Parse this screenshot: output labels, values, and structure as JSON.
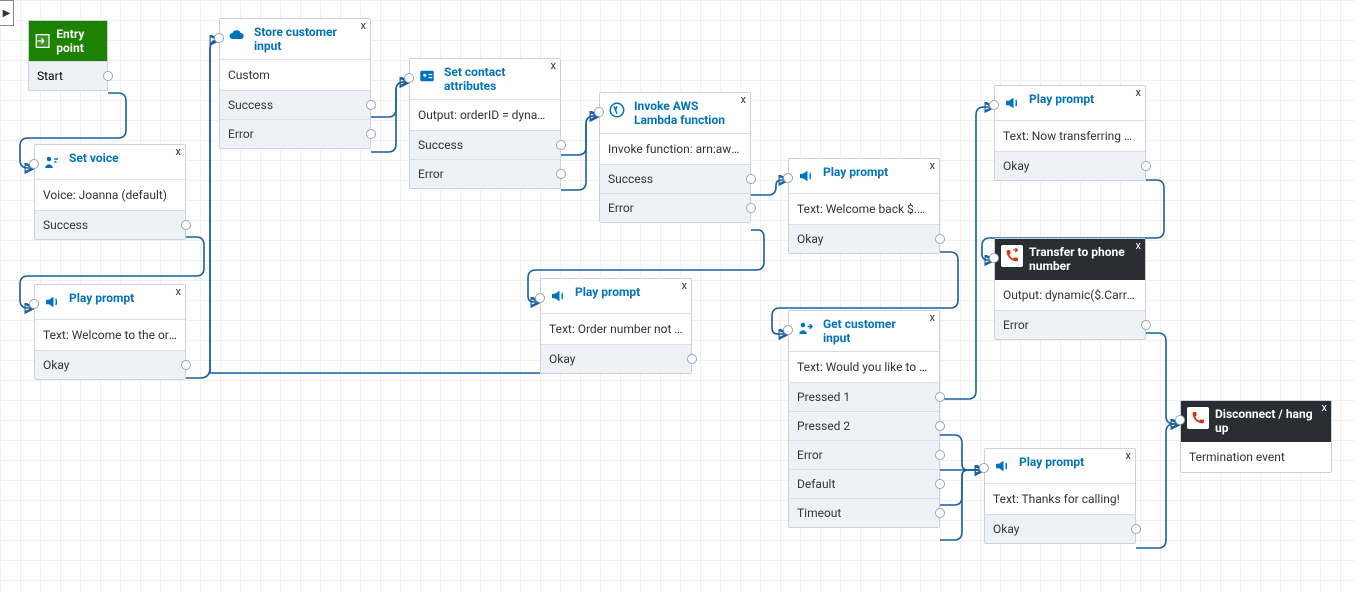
{
  "entry": {
    "title": "Entry point",
    "outLabel": "Start"
  },
  "setVoice": {
    "title": "Set voice",
    "detail": "Voice: Joanna (default)",
    "rows": [
      "Success"
    ]
  },
  "playWelcome": {
    "title": "Play prompt",
    "detail": "Text: Welcome to the order...",
    "rows": [
      "Okay"
    ]
  },
  "storeInput": {
    "title": "Store customer input",
    "detail": "Custom",
    "rows": [
      "Success",
      "Error"
    ]
  },
  "setAttrs": {
    "title": "Set contact attributes",
    "detail": "Output: orderID = dynamic...",
    "rows": [
      "Success",
      "Error"
    ]
  },
  "notFound": {
    "title": "Play prompt",
    "detail": "Text: Order number not fo...",
    "rows": [
      "Okay"
    ]
  },
  "lambda": {
    "title": "Invoke AWS Lambda function",
    "detail": "Invoke function: arn:aws:la...",
    "rows": [
      "Success",
      "Error"
    ]
  },
  "welcomeBack": {
    "title": "Play prompt",
    "detail": "Text: Welcome back $.Exter...",
    "rows": [
      "Okay"
    ]
  },
  "getInput": {
    "title": "Get customer input",
    "detail": "Text: Would you like to get ...",
    "rows": [
      "Pressed 1",
      "Pressed 2",
      "Error",
      "Default",
      "Timeout"
    ]
  },
  "transferring": {
    "title": "Play prompt",
    "detail": "Text: Now transferring you ...",
    "rows": [
      "Okay"
    ]
  },
  "transfer": {
    "title": "Transfer to phone number",
    "detail": "Output: dynamic($.Carrier...",
    "rows": [
      "Error"
    ]
  },
  "thanks": {
    "title": "Play prompt",
    "detail": "Text: Thanks for calling!",
    "rows": [
      "Okay"
    ]
  },
  "disconnect": {
    "title": "Disconnect / hang up",
    "detail": "Termination event"
  }
}
